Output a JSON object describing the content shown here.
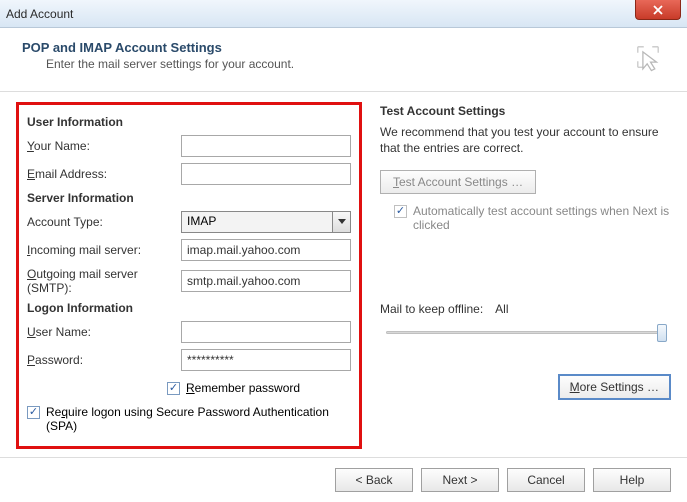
{
  "window": {
    "title": "Add Account"
  },
  "header": {
    "title": "POP and IMAP Account Settings",
    "subtitle": "Enter the mail server settings for your account."
  },
  "user_info": {
    "heading": "User Information",
    "name_label": "Your Name:",
    "name_value": "",
    "email_label": "Email Address:",
    "email_value": ""
  },
  "server_info": {
    "heading": "Server Information",
    "account_type_label": "Account Type:",
    "account_type_value": "IMAP",
    "incoming_label": "Incoming mail server:",
    "incoming_value": "imap.mail.yahoo.com",
    "outgoing_label": "Outgoing mail server (SMTP):",
    "outgoing_value": "smtp.mail.yahoo.com"
  },
  "logon_info": {
    "heading": "Logon Information",
    "user_label": "User Name:",
    "user_value": "",
    "password_label": "Password:",
    "password_value": "**********",
    "remember_label": "Remember password",
    "spa_label": "Require logon using Secure Password Authentication (SPA)"
  },
  "test": {
    "heading": "Test Account Settings",
    "desc": "We recommend that you test your account to ensure that the entries are correct.",
    "btn": "Test Account Settings …",
    "auto_label": "Automatically test account settings when Next is clicked"
  },
  "mail_keep": {
    "label": "Mail to keep offline:",
    "value": "All"
  },
  "more_settings": "More Settings …",
  "footer": {
    "back": "< Back",
    "next": "Next >",
    "cancel": "Cancel",
    "help": "Help"
  },
  "checkboxes": {
    "remember": true,
    "spa": true,
    "auto_test": true
  }
}
